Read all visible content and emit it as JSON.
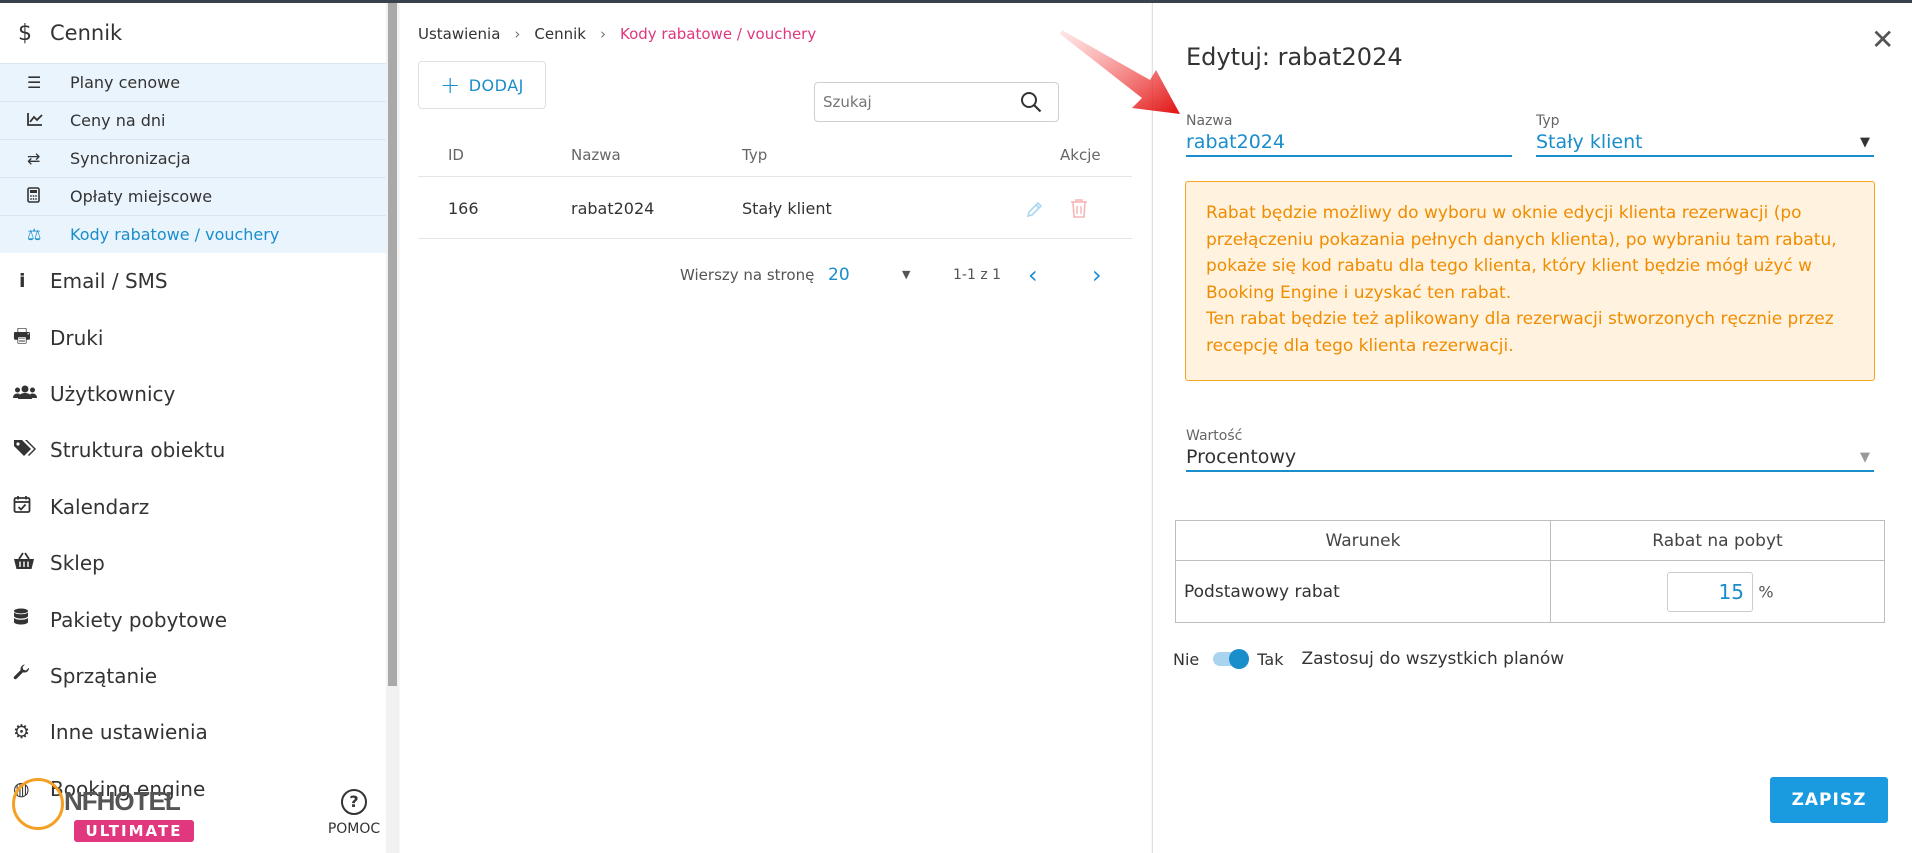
{
  "sidebar": {
    "section_title": "Cennik",
    "section_icon": "$",
    "sub_items": [
      {
        "label": "Plany cenowe",
        "icon": "list-icon"
      },
      {
        "label": "Ceny na dni",
        "icon": "chart-line-icon"
      },
      {
        "label": "Synchronizacja",
        "icon": "sync-icon"
      },
      {
        "label": "Opłaty miejscowe",
        "icon": "calculator-icon"
      },
      {
        "label": "Kody rabatowe / vouchery",
        "icon": "balance-icon",
        "active": true
      }
    ],
    "items": [
      {
        "label": "Email / SMS",
        "icon": "info-icon"
      },
      {
        "label": "Druki",
        "icon": "printer-icon"
      },
      {
        "label": "Użytkownicy",
        "icon": "users-icon"
      },
      {
        "label": "Struktura obiektu",
        "icon": "tags-icon"
      },
      {
        "label": "Kalendarz",
        "icon": "calendar-check-icon"
      },
      {
        "label": "Sklep",
        "icon": "basket-icon"
      },
      {
        "label": "Pakiety pobytowe",
        "icon": "database-icon"
      },
      {
        "label": "Sprzątanie",
        "icon": "wrench-icon"
      },
      {
        "label": "Inne ustawienia",
        "icon": "cogs-icon"
      },
      {
        "label": "Booking engine",
        "icon": "globe-icon"
      }
    ],
    "logo_text": "NFHOTEL",
    "logo_badge": "ULTIMATE",
    "help_label": "POMOC"
  },
  "breadcrumb": {
    "items": [
      "Ustawienia",
      "Cennik"
    ],
    "current": "Kody rabatowe / vouchery"
  },
  "toolbar": {
    "add_label": "DODAJ",
    "search_placeholder": "Szukaj"
  },
  "table": {
    "columns": [
      "ID",
      "Nazwa",
      "Typ",
      "Akcje"
    ],
    "rows": [
      {
        "id": "166",
        "name": "rabat2024",
        "type": "Stały klient"
      }
    ]
  },
  "pagination": {
    "rows_per_page_label": "Wierszy na stronę",
    "rows_per_page": "20",
    "range": "1-1 z 1"
  },
  "edit_panel": {
    "title": "Edytuj: rabat2024",
    "name_label": "Nazwa",
    "name_value": "rabat2024",
    "type_label": "Typ",
    "type_value": "Stały klient",
    "info_line1": "Rabat będzie możliwy do wyboru w oknie edycji klienta rezerwacji (po przełączeniu pokazania pełnych danych klienta), po wybraniu tam rabatu, pokaże się kod rabatu dla tego klienta, który klient będzie mógł użyć w Booking Engine i uzyskać ten rabat.",
    "info_line2": "Ten rabat będzie też aplikowany dla rezerwacji stworzonych ręcznie przez recepcję dla tego klienta rezerwacji.",
    "value_label": "Wartość",
    "value_value": "Procentowy",
    "cond_header": "Warunek",
    "discount_header": "Rabat na pobyt",
    "cond_row_label": "Podstawowy rabat",
    "discount_value": "15",
    "discount_unit": "%",
    "toggle_no": "Nie",
    "toggle_yes": "Tak",
    "toggle_on": true,
    "toggle_label": "Zastosuj do wszystkich planów",
    "save_label": "ZAPISZ"
  },
  "colors": {
    "accent": "#1a8dcb",
    "breadcrumb_current": "#e0377f",
    "info_text": "#f08c00",
    "info_bg": "#fff3e0",
    "save_button": "#1a9be0"
  }
}
